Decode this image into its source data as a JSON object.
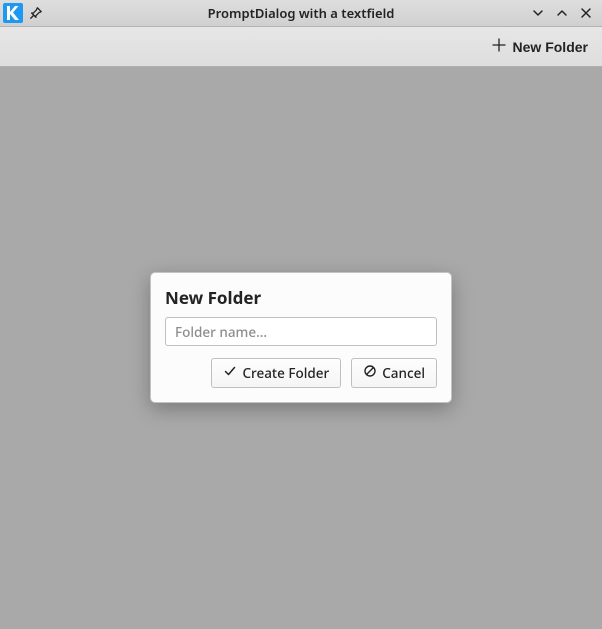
{
  "titlebar": {
    "title": "PromptDialog with a textfield"
  },
  "toolbar": {
    "new_folder_label": "New Folder"
  },
  "dialog": {
    "title": "New Folder",
    "input_value": "",
    "input_placeholder": "Folder name...",
    "create_label": "Create Folder",
    "cancel_label": "Cancel"
  }
}
